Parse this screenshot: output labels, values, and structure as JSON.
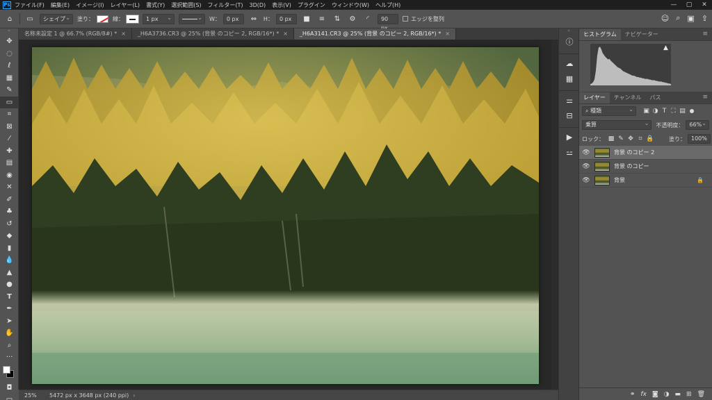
{
  "app": {
    "logo": "Ps"
  },
  "menu": [
    "ファイル(F)",
    "編集(E)",
    "イメージ(I)",
    "レイヤー(L)",
    "書式(Y)",
    "選択範囲(S)",
    "フィルター(T)",
    "3D(D)",
    "表示(V)",
    "プラグイン",
    "ウィンドウ(W)",
    "ヘルプ(H)"
  ],
  "window_controls": {
    "minimize": "—",
    "maximize": "▢",
    "close": "✕"
  },
  "options": {
    "shape_mode": "シェイプ",
    "fill_label": "塗り：",
    "stroke_label": "線：",
    "stroke_width": "1 px",
    "w_label": "W：",
    "w_value": "0 px",
    "h_label": "H：",
    "h_value": "0 px",
    "radius_value": "90 px",
    "align_edges_label": "エッジを整列"
  },
  "tabs": [
    {
      "label": "名称未設定 1 @ 66.7% (RGB/8#) *",
      "close": "×"
    },
    {
      "label": "_H6A3736.CR3 @ 25% (背景 のコピー 2, RGB/16*) *",
      "close": "×"
    },
    {
      "label": "_H6A3141.CR3 @ 25% (背景 のコピー 2, RGB/16*) *",
      "close": "×"
    }
  ],
  "status": {
    "zoom": "25%",
    "doc_info": "5472 px x 3648 px (240 ppi)",
    "arrow": "›"
  },
  "panels": {
    "histogram_tabs": [
      "ヒストグラム",
      "ナビゲーター"
    ],
    "histogram_warning": "▲",
    "layer_tabs": [
      "レイヤー",
      "チャンネル",
      "パス"
    ],
    "filter_kind": "種類",
    "blend_mode": "乗算",
    "opacity_label": "不透明度：",
    "opacity_value": "66%",
    "lock_label": "ロック：",
    "fill_label": "塗り：",
    "fill_value": "100%",
    "layers": [
      {
        "name": "背景 のコピー 2",
        "selected": true,
        "locked": false
      },
      {
        "name": "背景 のコピー",
        "selected": false,
        "locked": false
      },
      {
        "name": "背景",
        "selected": false,
        "locked": true
      }
    ]
  },
  "histogram": {
    "levels": [
      2,
      3,
      5,
      9,
      22,
      45,
      58,
      60,
      56,
      50,
      47,
      44,
      42,
      40,
      41,
      38,
      36,
      34,
      32,
      30,
      28,
      27,
      26,
      24,
      22,
      21,
      20,
      19,
      18,
      17,
      16,
      15,
      15,
      14,
      13,
      13,
      12,
      12,
      11,
      11,
      10,
      10,
      10,
      9,
      9,
      8,
      8,
      8,
      7,
      7,
      6,
      6,
      6,
      5,
      5,
      4,
      4,
      3,
      3,
      2
    ]
  }
}
